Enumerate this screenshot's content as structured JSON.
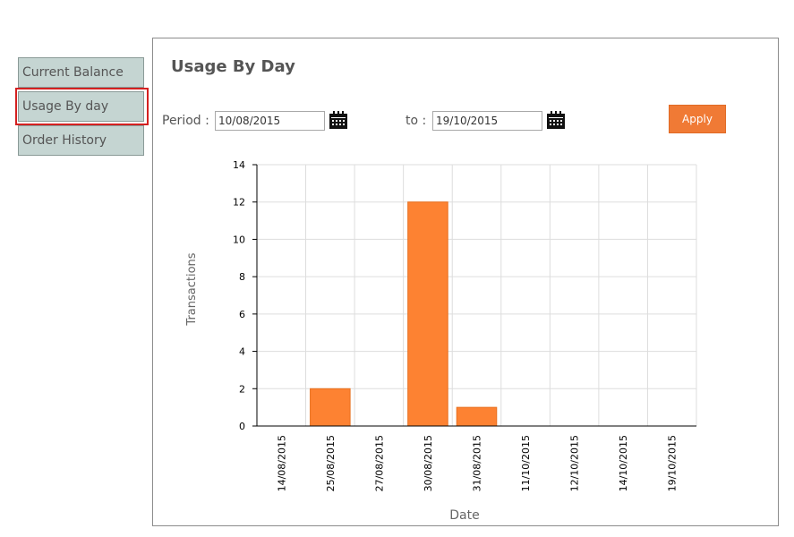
{
  "sidebar": {
    "items": [
      {
        "label": "Current Balance"
      },
      {
        "label": "Usage By day"
      },
      {
        "label": "Order History"
      }
    ]
  },
  "main": {
    "title": "Usage By Day",
    "period_label": "Period :",
    "from_date": "10/08/2015",
    "to_label": "to :",
    "to_date": "19/10/2015",
    "apply_label": "Apply"
  },
  "colors": {
    "accent": "#f07a35",
    "bar": "#fd8232",
    "sidebar_bg": "#c5d5d2",
    "selected_outline": "#d42020"
  },
  "chart_data": {
    "type": "bar",
    "categories": [
      "14/08/2015",
      "25/08/2015",
      "27/08/2015",
      "30/08/2015",
      "31/08/2015",
      "11/10/2015",
      "12/10/2015",
      "14/10/2015",
      "19/10/2015"
    ],
    "values": [
      0,
      2,
      0,
      12,
      1,
      0,
      0,
      0,
      0
    ],
    "xlabel": "Date",
    "ylabel": "Transactions",
    "ylim": [
      0,
      14
    ],
    "yticks": [
      0,
      2,
      4,
      6,
      8,
      10,
      12,
      14
    ],
    "grid": true
  }
}
